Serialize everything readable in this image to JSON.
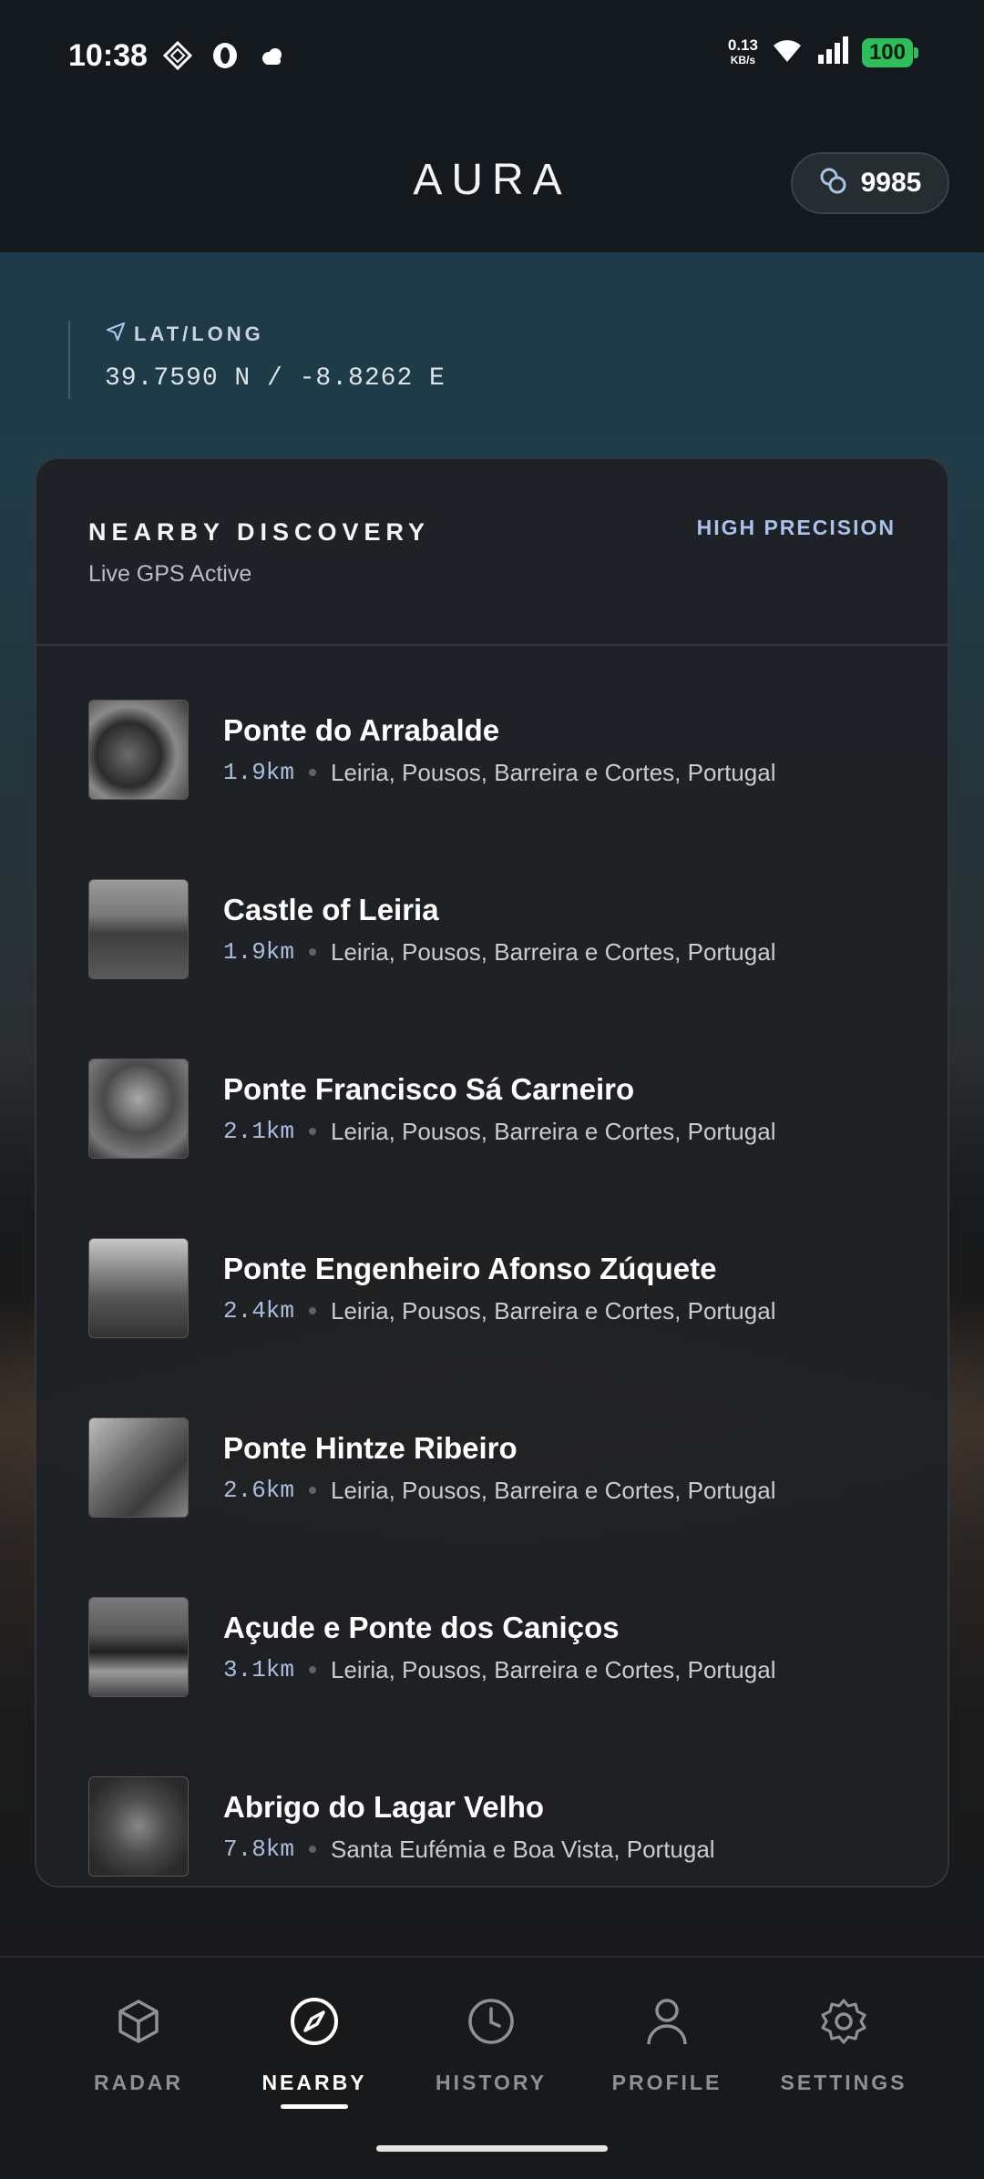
{
  "status_bar": {
    "time": "10:38",
    "network_speed": "0.13",
    "network_unit": "KB/s",
    "battery": "100",
    "battery_color": "#2fbf5a"
  },
  "header": {
    "app_title": "AURA",
    "points": "9985"
  },
  "location": {
    "label": "LAT/LONG",
    "value": "39.7590 N / -8.8262 E"
  },
  "nearby": {
    "title": "NEARBY DISCOVERY",
    "subtitle": "Live GPS Active",
    "badge": "HIGH PRECISION",
    "items": [
      {
        "name": "Ponte do Arrabalde",
        "distance": "1.9km",
        "location": "Leiria, Pousos, Barreira e Cortes, Portugal"
      },
      {
        "name": "Castle of Leiria",
        "distance": "1.9km",
        "location": "Leiria, Pousos, Barreira e Cortes, Portugal"
      },
      {
        "name": "Ponte Francisco Sá Carneiro",
        "distance": "2.1km",
        "location": "Leiria, Pousos, Barreira e Cortes, Portugal"
      },
      {
        "name": "Ponte Engenheiro Afonso Zúquete",
        "distance": "2.4km",
        "location": "Leiria, Pousos, Barreira e Cortes, Portugal"
      },
      {
        "name": "Ponte Hintze Ribeiro",
        "distance": "2.6km",
        "location": "Leiria, Pousos, Barreira e Cortes, Portugal"
      },
      {
        "name": "Açude e Ponte dos Caniços",
        "distance": "3.1km",
        "location": "Leiria, Pousos, Barreira e Cortes, Portugal"
      },
      {
        "name": "Abrigo do Lagar Velho",
        "distance": "7.8km",
        "location": "Santa Eufémia e Boa Vista, Portugal"
      }
    ]
  },
  "nav": {
    "items": [
      {
        "label": "RADAR",
        "icon": "cube-icon"
      },
      {
        "label": "NEARBY",
        "icon": "compass-icon",
        "active": true
      },
      {
        "label": "HISTORY",
        "icon": "clock-icon"
      },
      {
        "label": "PROFILE",
        "icon": "user-icon"
      },
      {
        "label": "SETTINGS",
        "icon": "gear-icon"
      }
    ]
  },
  "colors": {
    "accent": "#a9c2ec",
    "distance": "#a9bde0"
  }
}
